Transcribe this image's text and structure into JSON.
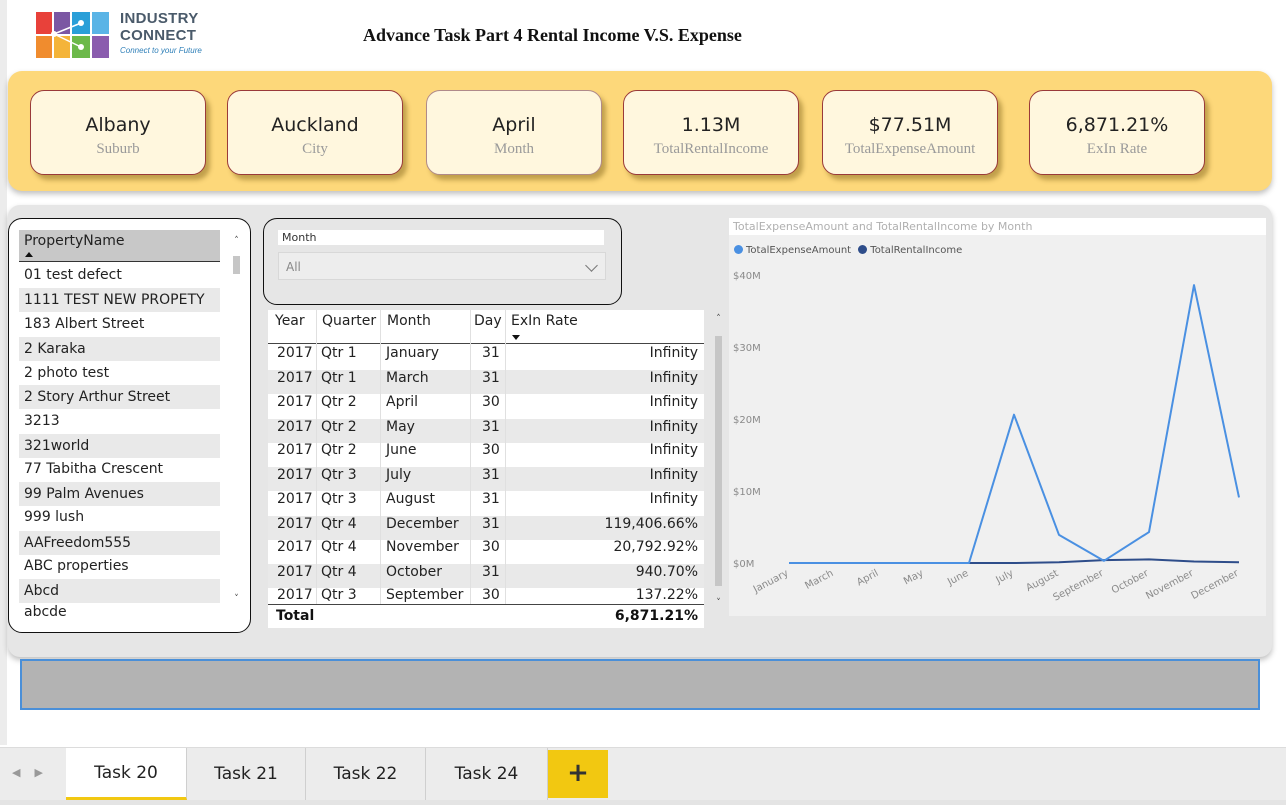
{
  "report": {
    "title": "Advance Task Part 4 Rental Income V.S. Expense"
  },
  "logo": {
    "line1": "INDUSTRY",
    "line2": "CONNECT",
    "tagline": "Connect to your Future"
  },
  "cards": [
    {
      "value": "Albany",
      "label": "Suburb"
    },
    {
      "value": "Auckland",
      "label": "City"
    },
    {
      "value": "April",
      "label": "Month"
    },
    {
      "value": "1.13M",
      "label": "TotalRentalIncome"
    },
    {
      "value": "$77.51M",
      "label": "TotalExpenseAmount"
    },
    {
      "value": "6,871.21%",
      "label": "ExIn Rate"
    }
  ],
  "property_slicer": {
    "header": "PropertyName",
    "items": [
      "01 test defect",
      "1111 TEST NEW PROPETY",
      "183 Albert Street",
      "2 Karaka",
      "2 photo test",
      "2 Story Arthur Street",
      "3213",
      "321world",
      "77 Tabitha Crescent",
      "99 Palm Avenues",
      "999 lush",
      "AAFreedom555",
      "ABC properties",
      "Abcd",
      "abcde"
    ]
  },
  "month_slicer": {
    "title": "Month",
    "value": "All"
  },
  "table": {
    "columns": [
      "Year",
      "Quarter",
      "Month",
      "Day",
      "ExIn Rate"
    ],
    "rows": [
      {
        "year": "2017",
        "quarter": "Qtr 1",
        "month": "January",
        "day": "31",
        "rate": "Infinity"
      },
      {
        "year": "2017",
        "quarter": "Qtr 1",
        "month": "March",
        "day": "31",
        "rate": "Infinity"
      },
      {
        "year": "2017",
        "quarter": "Qtr 2",
        "month": "April",
        "day": "30",
        "rate": "Infinity"
      },
      {
        "year": "2017",
        "quarter": "Qtr 2",
        "month": "May",
        "day": "31",
        "rate": "Infinity"
      },
      {
        "year": "2017",
        "quarter": "Qtr 2",
        "month": "June",
        "day": "30",
        "rate": "Infinity"
      },
      {
        "year": "2017",
        "quarter": "Qtr 3",
        "month": "July",
        "day": "31",
        "rate": "Infinity"
      },
      {
        "year": "2017",
        "quarter": "Qtr 3",
        "month": "August",
        "day": "31",
        "rate": "Infinity"
      },
      {
        "year": "2017",
        "quarter": "Qtr 4",
        "month": "December",
        "day": "31",
        "rate": "119,406.66%"
      },
      {
        "year": "2017",
        "quarter": "Qtr 4",
        "month": "November",
        "day": "30",
        "rate": "20,792.92%"
      },
      {
        "year": "2017",
        "quarter": "Qtr 4",
        "month": "October",
        "day": "31",
        "rate": "940.70%"
      },
      {
        "year": "2017",
        "quarter": "Qtr 3",
        "month": "September",
        "day": "30",
        "rate": "137.22%"
      }
    ],
    "total_label": "Total",
    "total_value": "6,871.21%"
  },
  "chart_data": {
    "type": "line",
    "title": "TotalExpenseAmount and TotalRentalIncome by Month",
    "categories": [
      "January",
      "March",
      "April",
      "May",
      "June",
      "July",
      "August",
      "September",
      "October",
      "November",
      "December"
    ],
    "series": [
      {
        "name": "TotalExpenseAmount",
        "color": "#4a90e2",
        "values": [
          0,
          0,
          0,
          0,
          0,
          20.6,
          3.9,
          0.3,
          4.3,
          38.6,
          9.1
        ]
      },
      {
        "name": "TotalRentalIncome",
        "color": "#2e4d8a",
        "values": [
          0,
          0,
          0,
          0,
          0,
          0,
          0.1,
          0.4,
          0.5,
          0.2,
          0.1
        ]
      }
    ],
    "y_ticks": [
      "$0M",
      "$10M",
      "$20M",
      "$30M",
      "$40M"
    ],
    "y_tick_values": [
      0,
      10,
      20,
      30,
      40
    ],
    "ylim": [
      0,
      40
    ],
    "legend_position": "top-left",
    "grid": false
  },
  "tabs": [
    {
      "label": "Task 20",
      "active": true
    },
    {
      "label": "Task 21",
      "active": false
    },
    {
      "label": "Task 22",
      "active": false
    },
    {
      "label": "Task 24",
      "active": false
    }
  ],
  "tab_add_label": "+",
  "colors": {
    "card_band": "#fdd87a",
    "card_bg": "#fff7de",
    "card_border": "#9a3a3a",
    "accent_yellow": "#f2c811",
    "selection_blue": "#4a8fd8"
  }
}
